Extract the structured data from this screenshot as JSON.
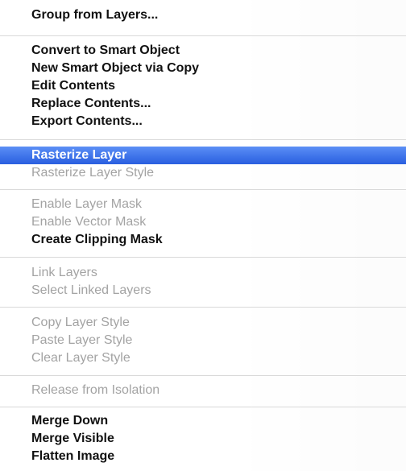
{
  "menu": {
    "groups": [
      {
        "items": [
          {
            "label": "Group from Layers...",
            "enabled": true
          }
        ]
      },
      {
        "items": [
          {
            "label": "Convert to Smart Object",
            "enabled": true
          },
          {
            "label": "New Smart Object via Copy",
            "enabled": true
          },
          {
            "label": "Edit Contents",
            "enabled": true
          },
          {
            "label": "Replace Contents...",
            "enabled": true
          },
          {
            "label": "Export Contents...",
            "enabled": true
          }
        ]
      },
      {
        "items": [
          {
            "label": "Rasterize Layer",
            "enabled": true,
            "selected": true
          },
          {
            "label": "Rasterize Layer Style",
            "enabled": false
          }
        ]
      },
      {
        "items": [
          {
            "label": "Enable Layer Mask",
            "enabled": false
          },
          {
            "label": "Enable Vector Mask",
            "enabled": false
          },
          {
            "label": "Create Clipping Mask",
            "enabled": true
          }
        ]
      },
      {
        "items": [
          {
            "label": "Link Layers",
            "enabled": false
          },
          {
            "label": "Select Linked Layers",
            "enabled": false
          }
        ]
      },
      {
        "items": [
          {
            "label": "Copy Layer Style",
            "enabled": false
          },
          {
            "label": "Paste Layer Style",
            "enabled": false
          },
          {
            "label": "Clear Layer Style",
            "enabled": false
          }
        ]
      },
      {
        "items": [
          {
            "label": "Release from Isolation",
            "enabled": false
          }
        ]
      },
      {
        "items": [
          {
            "label": "Merge Down",
            "enabled": true
          },
          {
            "label": "Merge Visible",
            "enabled": true
          },
          {
            "label": "Flatten Image",
            "enabled": true
          }
        ]
      }
    ],
    "colors": {
      "selected_highlight": "#3f74ea",
      "enabled_text": "#111111",
      "disabled_text": "#a3a3a3"
    }
  }
}
